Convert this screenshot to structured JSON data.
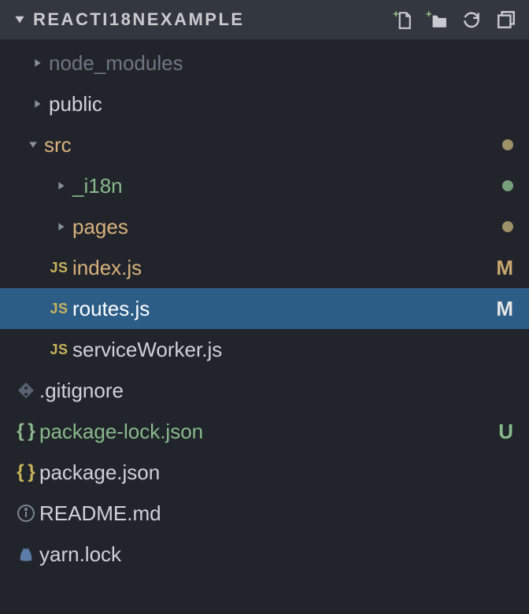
{
  "header": {
    "title": "REACTI18NEXAMPLE"
  },
  "tree": {
    "node_modules": "node_modules",
    "public": "public",
    "src": "src",
    "i18n": "_i18n",
    "pages": "pages",
    "index_js": "index.js",
    "routes_js": "routes.js",
    "serviceworker_js": "serviceWorker.js",
    "gitignore": ".gitignore",
    "package_lock": "package-lock.json",
    "package_json": "package.json",
    "readme": "README.md",
    "yarn_lock": "yarn.lock"
  },
  "status": {
    "index_js": "M",
    "routes_js": "M",
    "package_lock": "U"
  }
}
